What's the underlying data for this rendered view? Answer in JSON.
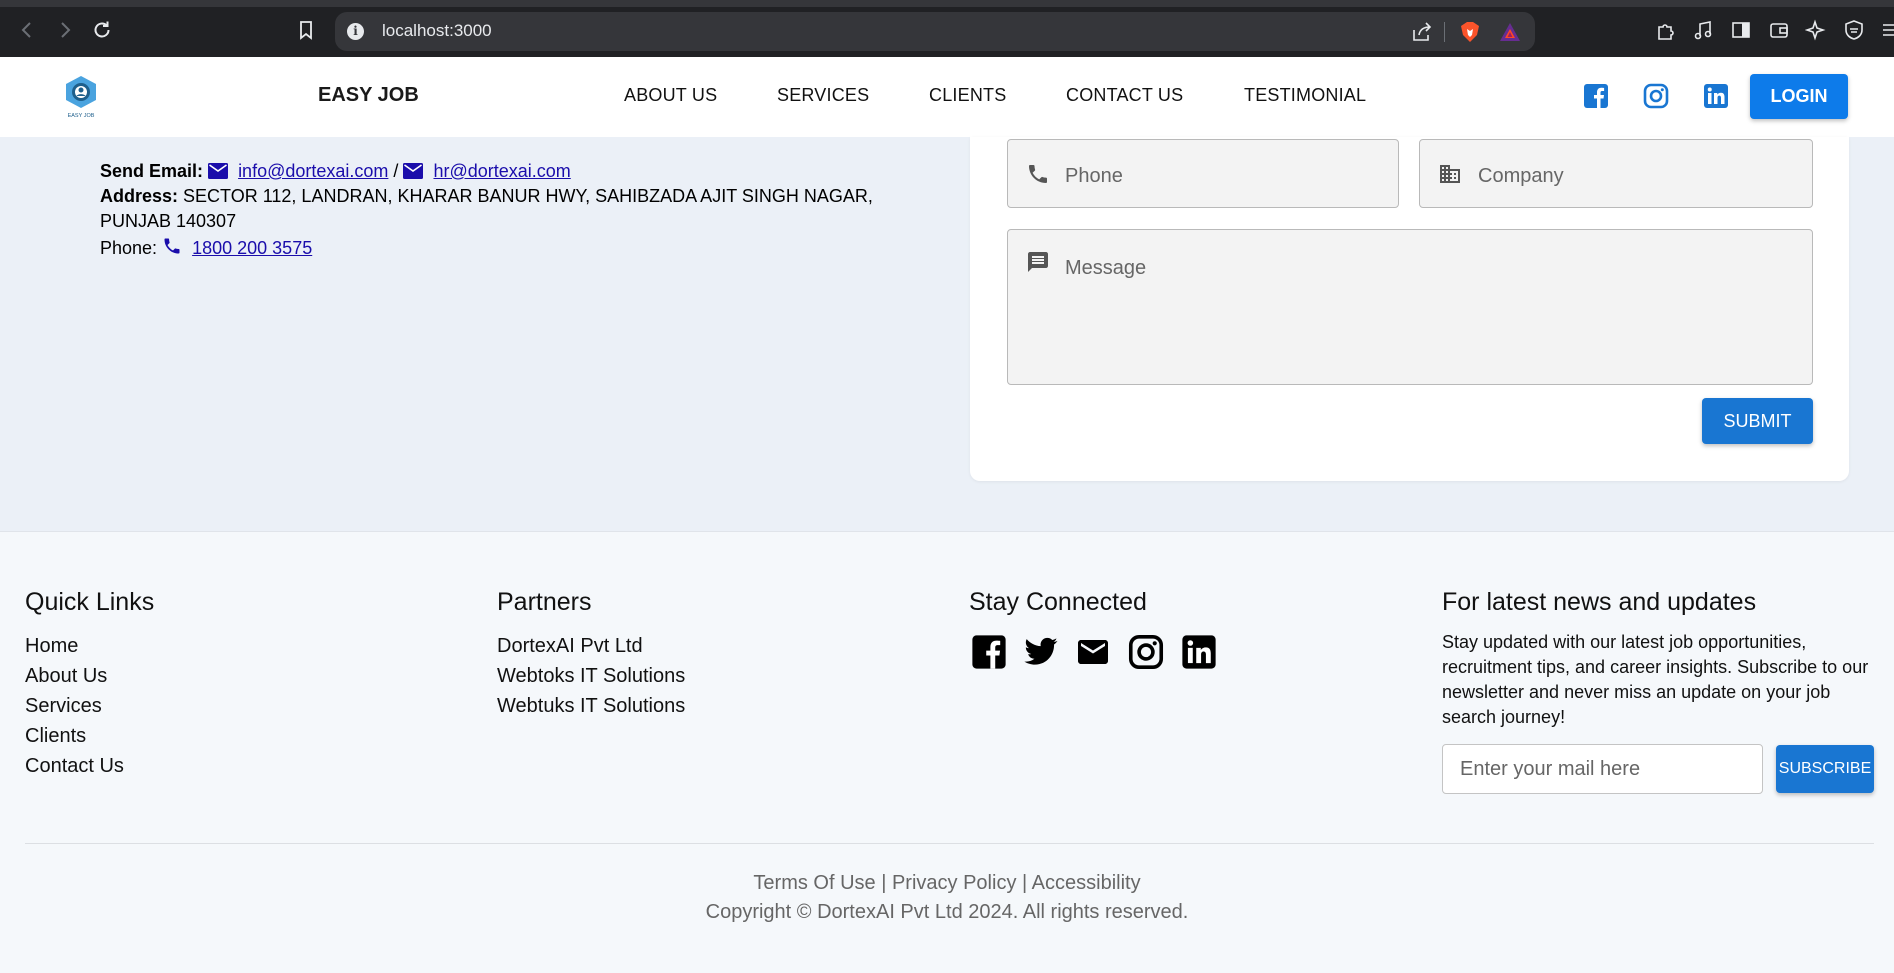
{
  "browser": {
    "url": "localhost:3000"
  },
  "header": {
    "brand": "EASY JOB",
    "logo_text": "EASY JOB",
    "menu": [
      {
        "label": "ABOUT US"
      },
      {
        "label": "SERVICES"
      },
      {
        "label": "CLIENTS"
      },
      {
        "label": "CONTACT US"
      },
      {
        "label": "TESTIMONIAL"
      }
    ],
    "login_label": "LOGIN",
    "accent_color": "#0d7bea"
  },
  "contact": {
    "send_email_label": "Send Email:",
    "email_1": "info@dortexai.com",
    "email_separator": "/",
    "email_2": "hr@dortexai.com",
    "address_label": "Address:",
    "address_line_1": "SECTOR 112, LANDRAN, KHARAR BANUR HWY, SAHIBZADA AJIT SINGH NAGAR,",
    "address_line_2": "PUNJAB 140307",
    "phone_label": "Phone:",
    "phone_number": "1800 200 3575"
  },
  "form": {
    "phone_placeholder": "Phone",
    "company_placeholder": "Company",
    "message_placeholder": "Message",
    "submit_label": "SUBMIT"
  },
  "footer": {
    "quick_links": {
      "heading": "Quick Links",
      "items": [
        "Home",
        "About Us",
        "Services",
        "Clients",
        "Contact Us"
      ]
    },
    "partners": {
      "heading": "Partners",
      "items": [
        "DortexAI Pvt Ltd",
        "Webtoks IT Solutions",
        "Webtuks IT Solutions"
      ]
    },
    "stay_connected": {
      "heading": "Stay Connected",
      "icons": [
        "facebook-icon",
        "twitter-icon",
        "mail-icon",
        "instagram-icon",
        "linkedin-icon"
      ]
    },
    "newsletter": {
      "heading": "For latest news and updates",
      "text": "Stay updated with our latest job opportunities, recruitment tips, and career insights. Subscribe to our newsletter and never miss an update on your job search journey!",
      "email_placeholder": "Enter your mail here",
      "subscribe_label": "SUBSCRIBE"
    },
    "legal": {
      "terms": "Terms Of Use",
      "privacy": "Privacy Policy",
      "accessibility": "Accessibility",
      "separator": " | ",
      "copyright": "Copyright © DortexAI Pvt Ltd 2024. All rights reserved."
    }
  }
}
